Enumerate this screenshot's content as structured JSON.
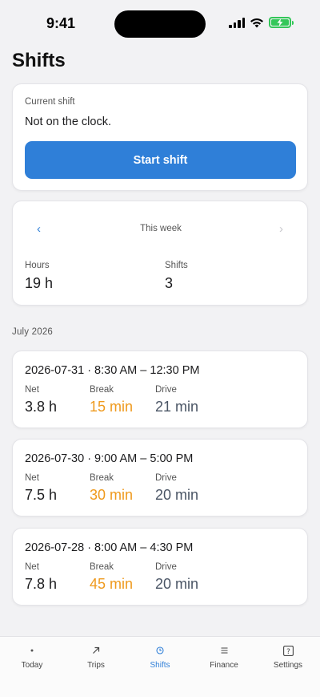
{
  "status_bar": {
    "time": "9:41",
    "battery_color": "#34c759",
    "icons": [
      "signal-icon",
      "wifi-icon",
      "battery-charging-icon"
    ]
  },
  "page": {
    "title": "Shifts"
  },
  "current_shift": {
    "label": "Current shift",
    "status": "Not on the clock.",
    "button_label": "Start shift",
    "button_color": "#2f7fd8"
  },
  "week": {
    "prev_glyph": "‹",
    "label": "This week",
    "next_glyph": "›",
    "hours_label": "Hours",
    "hours_value": "19 h",
    "shifts_label": "Shifts",
    "shifts_value": "3"
  },
  "history": {
    "month_header": "July 2026",
    "metric_labels": {
      "net": "Net",
      "break": "Break",
      "drive": "Drive"
    },
    "colors": {
      "break": "#ef9a1e",
      "drive": "#4a5565"
    },
    "shifts": [
      {
        "title": "2026-07-31 · 8:30 AM – 12:30 PM",
        "net": "3.8 h",
        "break": "15 min",
        "drive": "21 min"
      },
      {
        "title": "2026-07-30 · 9:00 AM – 5:00 PM",
        "net": "7.5 h",
        "break": "30 min",
        "drive": "20 min"
      },
      {
        "title": "2026-07-28 · 8:00 AM – 4:30 PM",
        "net": "7.8 h",
        "break": "45 min",
        "drive": "20 min"
      }
    ]
  },
  "tab_bar": {
    "active": "Shifts",
    "tabs": [
      {
        "label": "Today",
        "icon": "dot-icon"
      },
      {
        "label": "Trips",
        "icon": "arrow-up-right-icon"
      },
      {
        "label": "Shifts",
        "icon": "clock-icon"
      },
      {
        "label": "Finance",
        "icon": "list-icon"
      },
      {
        "label": "Settings",
        "icon": "question-box-icon"
      }
    ]
  }
}
